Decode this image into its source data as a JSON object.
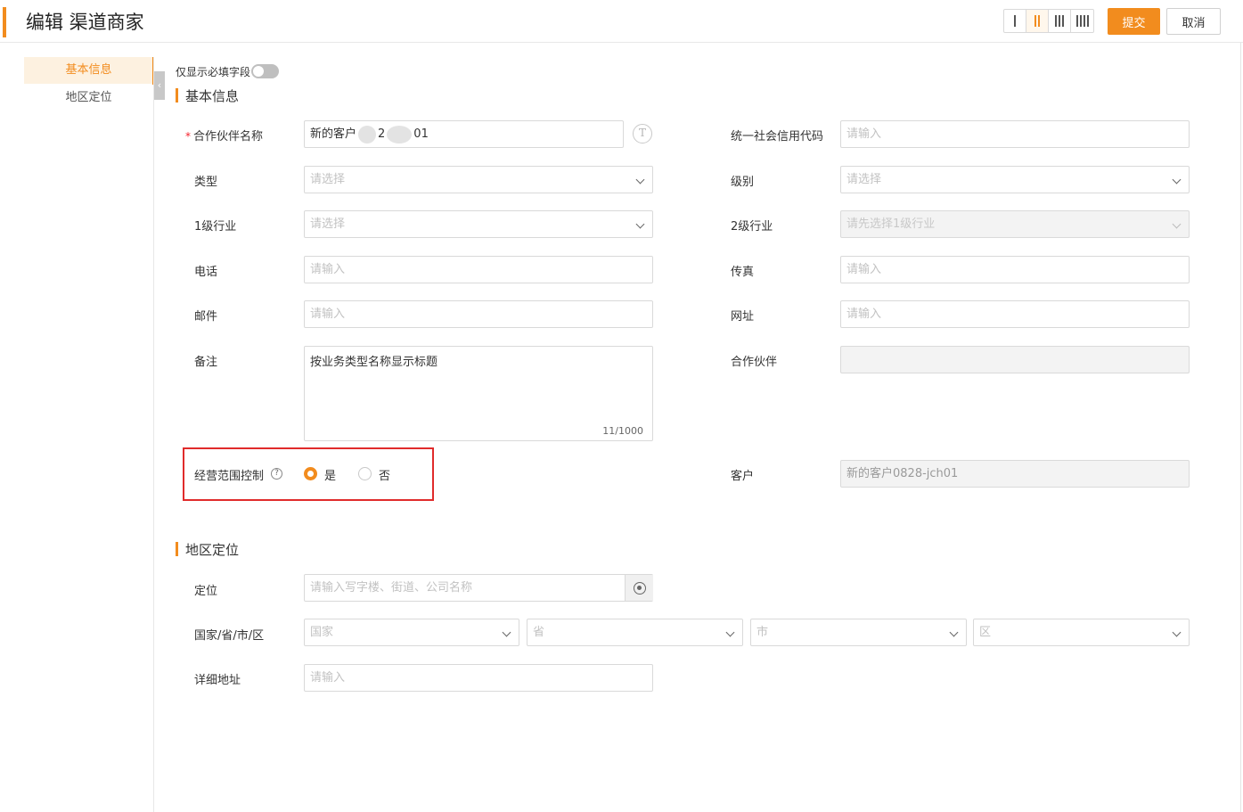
{
  "header": {
    "title": "编辑 渠道商家",
    "submit_label": "提交",
    "cancel_label": "取消",
    "column_options": [
      "1-column",
      "2-column",
      "3-column",
      "4-column"
    ],
    "active_columns": "2-column"
  },
  "sidenav": {
    "items": [
      {
        "label": "基本信息",
        "active": true
      },
      {
        "label": "地区定位",
        "active": false
      }
    ]
  },
  "toggle": {
    "label": "仅显示必填字段",
    "on": false
  },
  "sections": {
    "basic": {
      "title": "基本信息"
    },
    "region": {
      "title": "地区定位"
    }
  },
  "form": {
    "partner_name": {
      "label": "合作伙伴名称",
      "required": true,
      "value_visible": [
        "新的客户",
        "2",
        "01"
      ]
    },
    "credit_code": {
      "label": "统一社会信用代码",
      "placeholder": "请输入"
    },
    "type": {
      "label": "类型",
      "placeholder": "请选择"
    },
    "level": {
      "label": "级别",
      "placeholder": "请选择"
    },
    "industry1": {
      "label": "1级行业",
      "placeholder": "请选择"
    },
    "industry2": {
      "label": "2级行业",
      "placeholder": "请先选择1级行业"
    },
    "phone": {
      "label": "电话",
      "placeholder": "请输入"
    },
    "fax": {
      "label": "传真",
      "placeholder": "请输入"
    },
    "email": {
      "label": "邮件",
      "placeholder": "请输入"
    },
    "website": {
      "label": "网址",
      "placeholder": "请输入"
    },
    "remark": {
      "label": "备注",
      "value": "按业务类型名称显示标题",
      "counter": "11/1000"
    },
    "partner": {
      "label": "合作伙伴",
      "value": ""
    },
    "business_scope": {
      "label": "经营范围控制",
      "help": "?",
      "options": [
        "是",
        "否"
      ],
      "selected": "是"
    },
    "customer": {
      "label": "客户",
      "value": "新的客户0828-jch01"
    },
    "location": {
      "label": "定位",
      "placeholder": "请输入写字楼、街道、公司名称"
    },
    "region": {
      "label": "国家/省/市/区",
      "country_placeholder": "国家",
      "province_placeholder": "省",
      "city_placeholder": "市",
      "district_placeholder": "区"
    },
    "address": {
      "label": "详细地址",
      "placeholder": "请输入"
    }
  },
  "colors": {
    "accent": "#f28c1e",
    "highlight_box": "#e02b2b"
  }
}
